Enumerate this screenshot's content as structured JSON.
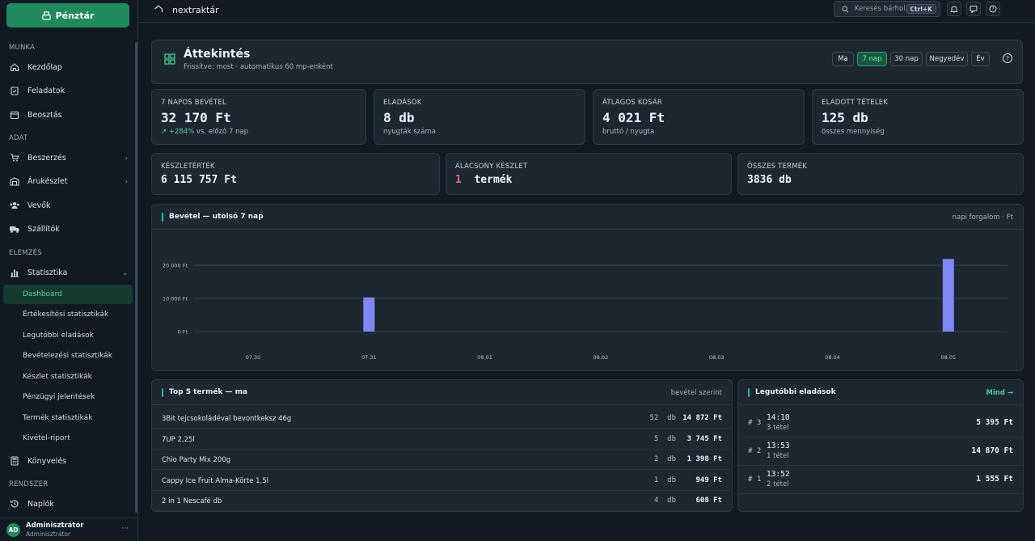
{
  "sidebar": {
    "pos_button": "Pénztár",
    "sections": {
      "munka": "MUNKA",
      "adat": "ADAT",
      "elemzes": "ELEMZÉS",
      "rendszer": "RENDSZER"
    },
    "items": {
      "kezdolap": "Kezdőlap",
      "feladatok": "Feladatok",
      "beosztas": "Beosztás",
      "beszerzes": "Beszerzés",
      "arukeszlet": "Árukészlet",
      "vevok": "Vevők",
      "szallitok": "Szállítók",
      "statisztika": "Statisztika",
      "konyveles": "Könyvelés",
      "naplok": "Naplók"
    },
    "sub_items": {
      "dashboard": "Dashboard",
      "ertekesitesi": "Értékesítési statisztikák",
      "legutobbi": "Legutóbbi eladások",
      "bevetelezesi": "Bevételezési statisztikák",
      "keszlet": "Készlet statisztikák",
      "penzugyi": "Pénzügyi jelentések",
      "termek": "Termék statisztikák",
      "kivetel": "Kivétel-riport"
    },
    "user": {
      "initials": "AD",
      "name": "Adminisztrátor",
      "role": "Adminisztrátor",
      "more": "···"
    }
  },
  "topbar": {
    "breadcrumb": "nextraktár",
    "search_placeholder": "Keresés bárhol...",
    "search_shortcut": "Ctrl+K"
  },
  "header": {
    "title": "Áttekintés",
    "subtitle": "Frissítve: most · automatikus 60 mp-enként",
    "ranges": {
      "ma": "Ma",
      "het": "7 nap",
      "harminc": "30 nap",
      "negyedev": "Negyedév",
      "ev": "Év"
    },
    "selected_range": "7 nap"
  },
  "kpis": {
    "revenue": {
      "label": "7 NAPOS BEVÉTEL",
      "value": "32 170 Ft",
      "trend": "↗ +284%",
      "trend_suffix": "vs. előző 7 nap"
    },
    "sales": {
      "label": "ELADÁSOK",
      "value": "8 db",
      "sub": "nyugták száma"
    },
    "basket": {
      "label": "ÁTLAGOS KOSÁR",
      "value": "4 021 Ft",
      "sub": "bruttó / nyugta"
    },
    "items_sold": {
      "label": "ELADOTT TÉTELEK",
      "value": "125 db",
      "sub": "összes mennyiség"
    },
    "stock_value": {
      "label": "KÉSZLETÉRTÉK",
      "value": "6 115 757 Ft"
    },
    "low_stock": {
      "label": "ALACSONY KÉSZLET",
      "count": "1",
      "unit": "termék"
    },
    "total_products": {
      "label": "ÖSSZES TERMÉK",
      "value": "3836 db"
    }
  },
  "revenue_panel": {
    "title": "Bevétel — utolsó 7 nap",
    "right": "napi forgalom · Ft"
  },
  "chart_data": {
    "type": "bar",
    "categories": [
      "07.30",
      "07.31",
      "08.01",
      "08.02",
      "08.03",
      "08.04",
      "08.05"
    ],
    "values": [
      0,
      10300,
      0,
      0,
      0,
      0,
      21900
    ],
    "y_ticks": [
      {
        "value": 0,
        "label": "0 Ft"
      },
      {
        "value": 10000,
        "label": "10 000 Ft"
      },
      {
        "value": 20000,
        "label": "20 000 Ft"
      }
    ],
    "ylim": [
      0,
      30000
    ],
    "grid": true,
    "color": "#8088f5"
  },
  "top5": {
    "title": "Top 5 termék — ma",
    "right": "bevétel szerint",
    "rows": [
      {
        "name": "3Bit tejcsokoládéval bevontkeksz 46g",
        "qty": "52",
        "unit": "db",
        "revenue": "14 872 Ft"
      },
      {
        "name": "7UP 2,25l",
        "qty": "5",
        "unit": "db",
        "revenue": "3 745 Ft"
      },
      {
        "name": "Chio Party Mix 200g",
        "qty": "2",
        "unit": "db",
        "revenue": "1 398 Ft"
      },
      {
        "name": "Cappy Ice Fruit Alma-Körte 1,5l",
        "qty": "1",
        "unit": "db",
        "revenue": "949 Ft"
      },
      {
        "name": "2 in 1 Nescafé db",
        "qty": "4",
        "unit": "db",
        "revenue": "608 Ft"
      }
    ]
  },
  "recent": {
    "title": "Legutóbbi eladások",
    "more": "Mind →",
    "rows": [
      {
        "id": "# 3",
        "time": "14:10",
        "items": "3 tétel",
        "amount": "5 395 Ft"
      },
      {
        "id": "# 2",
        "time": "13:53",
        "items": "1 tétel",
        "amount": "14 870 Ft"
      },
      {
        "id": "# 1",
        "time": "13:52",
        "items": "2 tétel",
        "amount": "1 555 Ft"
      }
    ]
  },
  "colors": {
    "accent": "#1e8a5e",
    "accent_text": "#52d39b",
    "bar": "#8088f5",
    "danger": "#ef6b6b"
  }
}
